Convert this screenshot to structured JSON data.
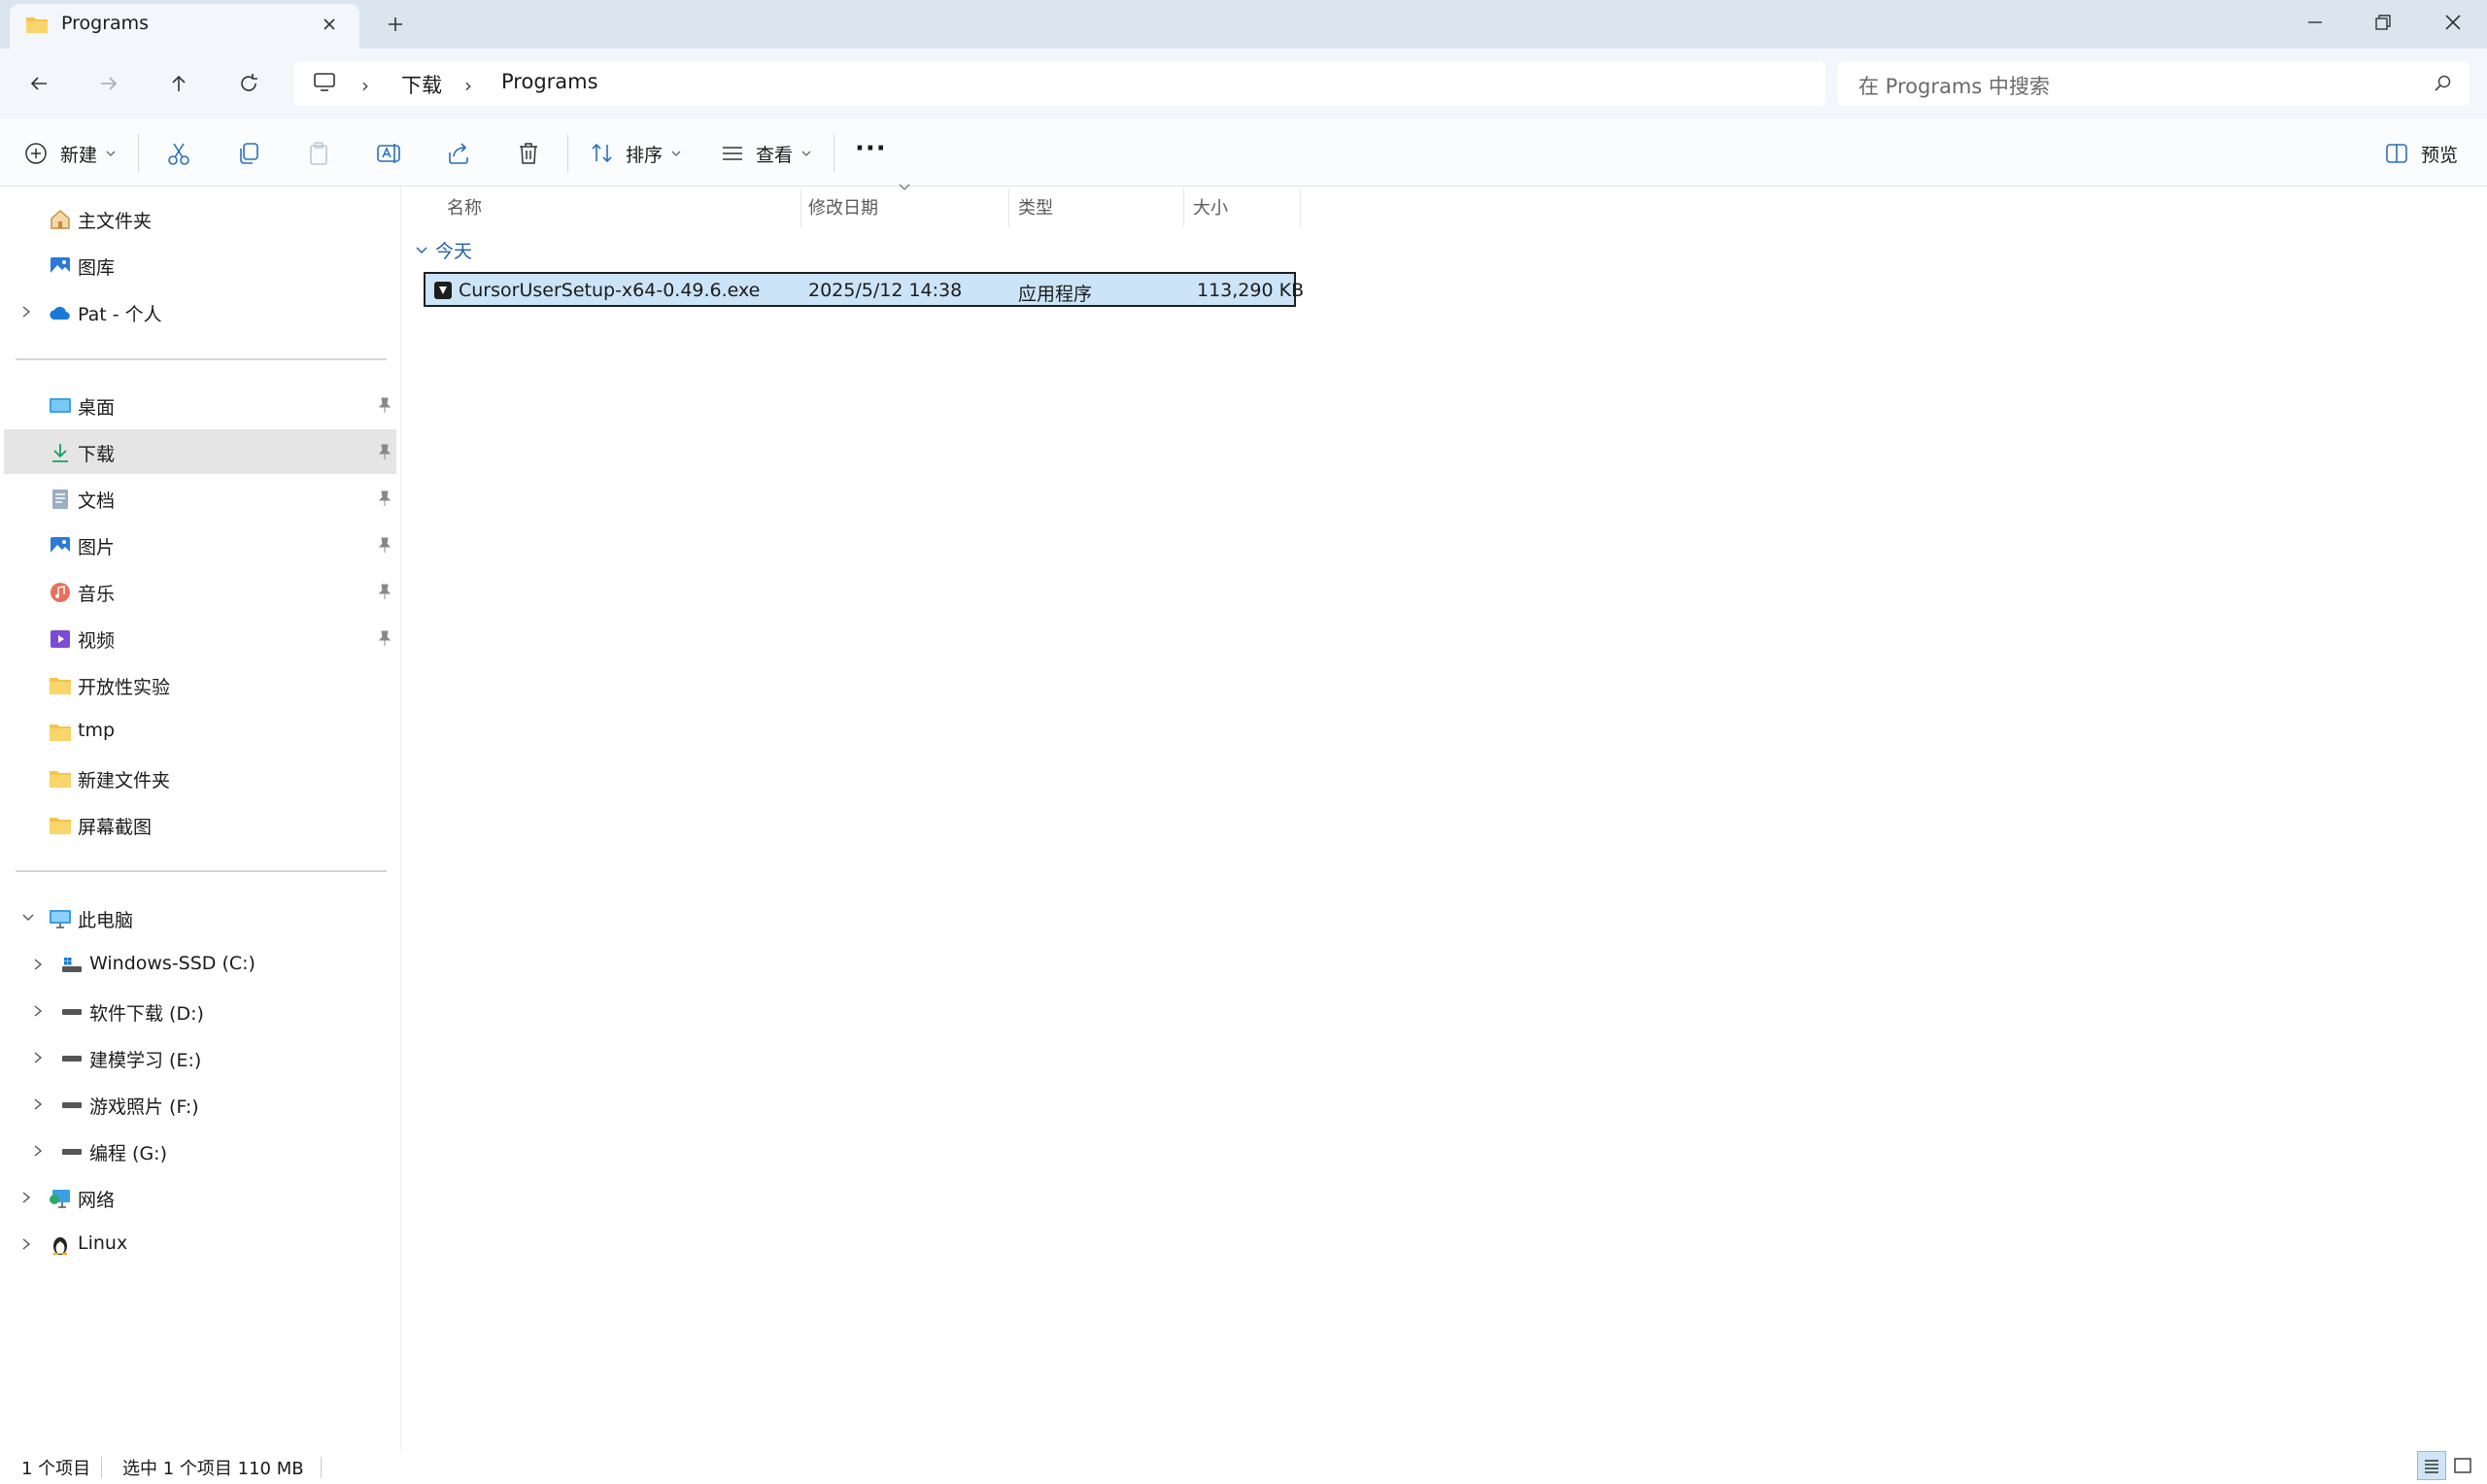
{
  "window": {
    "tab_title": "Programs"
  },
  "addressbar": {
    "breadcrumbs": [
      "下载",
      "Programs"
    ],
    "search_placeholder": "在 Programs 中搜索"
  },
  "commandbar": {
    "new_label": "新建",
    "sort_label": "排序",
    "view_label": "查看",
    "more_label": "···",
    "preview_label": "预览"
  },
  "sidebar": {
    "top": [
      {
        "label": "主文件夹",
        "icon": "home-icon"
      },
      {
        "label": "图库",
        "icon": "gallery-icon"
      },
      {
        "label": "Pat - 个人",
        "icon": "onedrive-cloud-icon"
      }
    ],
    "quick_access": [
      {
        "label": "桌面",
        "icon": "desktop-icon",
        "pinned": true
      },
      {
        "label": "下载",
        "icon": "download-icon",
        "pinned": true,
        "selected": true
      },
      {
        "label": "文档",
        "icon": "documents-icon",
        "pinned": true
      },
      {
        "label": "图片",
        "icon": "pictures-icon",
        "pinned": true
      },
      {
        "label": "音乐",
        "icon": "music-icon",
        "pinned": true
      },
      {
        "label": "视频",
        "icon": "videos-icon",
        "pinned": true
      },
      {
        "label": "开放性实验",
        "icon": "folder-icon"
      },
      {
        "label": "tmp",
        "icon": "folder-icon"
      },
      {
        "label": "新建文件夹",
        "icon": "folder-icon"
      },
      {
        "label": "屏幕截图",
        "icon": "folder-icon"
      }
    ],
    "this_pc": {
      "label": "此电脑",
      "icon": "computer-icon"
    },
    "drives": [
      {
        "label": "Windows-SSD (C:)",
        "icon": "system-drive-icon"
      },
      {
        "label": "软件下载 (D:)",
        "icon": "drive-icon"
      },
      {
        "label": "建模学习 (E:)",
        "icon": "drive-icon"
      },
      {
        "label": "游戏照片 (F:)",
        "icon": "drive-icon"
      },
      {
        "label": "编程 (G:)",
        "icon": "drive-icon"
      }
    ],
    "network": {
      "label": "网络",
      "icon": "network-icon"
    },
    "linux": {
      "label": "Linux",
      "icon": "linux-penguin-icon"
    }
  },
  "filelist": {
    "columns": [
      "名称",
      "修改日期",
      "类型",
      "大小"
    ],
    "group_label": "今天",
    "files": [
      {
        "name": "CursorUserSetup-x64-0.49.6.exe",
        "modified": "2025/5/12 14:38",
        "type": "应用程序",
        "size": "113,290 KB",
        "selected": true
      }
    ]
  },
  "statusbar": {
    "count": "1 个项目",
    "selected": "选中 1 个项目  110 MB"
  },
  "colors": {
    "titlebar": "#dbe5ef",
    "selection": "#cce4f7",
    "accent": "#1e5fa8",
    "folder": "#f4c34a"
  }
}
